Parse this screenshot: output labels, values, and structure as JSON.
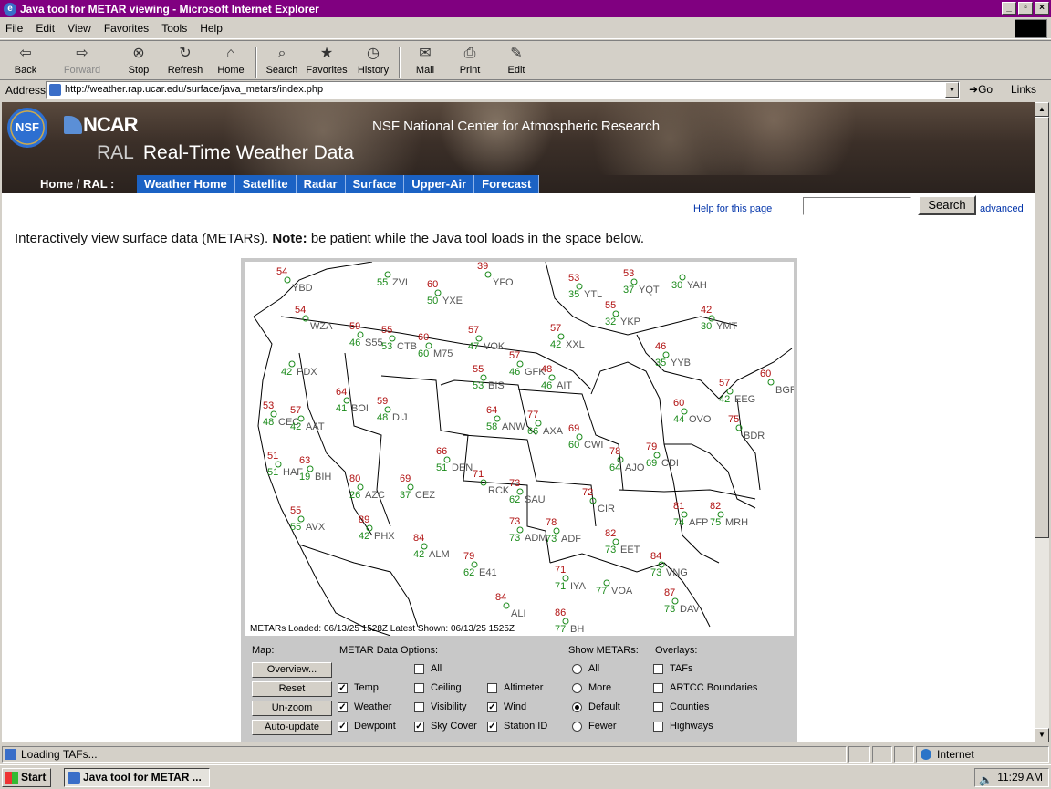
{
  "window": {
    "title": "Java tool for METAR viewing - Microsoft Internet Explorer"
  },
  "menu": [
    "File",
    "Edit",
    "View",
    "Favorites",
    "Tools",
    "Help"
  ],
  "toolbar": {
    "back": "Back",
    "forward": "Forward",
    "stop": "Stop",
    "refresh": "Refresh",
    "home": "Home",
    "search": "Search",
    "favorites": "Favorites",
    "history": "History",
    "mail": "Mail",
    "print": "Print",
    "edit": "Edit"
  },
  "address": {
    "label": "Address",
    "url": "http://weather.rap.ucar.edu/surface/java_metars/index.php",
    "go": "Go",
    "links": "Links"
  },
  "banner": {
    "nsf": "NSF",
    "ncar": "NCAR",
    "center": "NSF National Center for Atmospheric Research",
    "ral": "RAL",
    "title": "Real-Time Weather Data",
    "breadcrumb": "Home / RAL :",
    "tabs": [
      "Weather Home",
      "Satellite",
      "Radar",
      "Surface",
      "Upper-Air",
      "Forecast"
    ]
  },
  "search": {
    "help": "Help for this page",
    "button": "Search",
    "advanced": "advanced",
    "value": ""
  },
  "intro": {
    "text": "Interactively view surface data (METARs).",
    "note_label": "Note:",
    "note": "be patient while the Java tool loads in the space below."
  },
  "applet": {
    "status": "METARs Loaded: 06/13/25 1528Z Latest Shown: 06/13/25 1525Z",
    "map_label": "Map:",
    "map_buttons": [
      "Overview...",
      "Reset",
      "Un-zoom",
      "Auto-update"
    ],
    "metar_label": "METAR Data Options:",
    "options": [
      {
        "label": "All",
        "checked": false
      },
      {
        "label": "Temp",
        "checked": true
      },
      {
        "label": "Ceiling",
        "checked": false
      },
      {
        "label": "Altimeter",
        "checked": false
      },
      {
        "label": "Weather",
        "checked": true
      },
      {
        "label": "Visibility",
        "checked": false
      },
      {
        "label": "Wind",
        "checked": true
      },
      {
        "label": "Dewpoint",
        "checked": true
      },
      {
        "label": "Sky Cover",
        "checked": true
      },
      {
        "label": "Station ID",
        "checked": true
      }
    ],
    "show_label": "Show METARs:",
    "show": [
      {
        "label": "All",
        "selected": false
      },
      {
        "label": "More",
        "selected": false
      },
      {
        "label": "Default",
        "selected": true
      },
      {
        "label": "Fewer",
        "selected": false
      }
    ],
    "overlay_label": "Overlays:",
    "overlays": [
      {
        "label": "TAFs",
        "checked": false
      },
      {
        "label": "ARTCC Boundaries",
        "checked": false
      },
      {
        "label": "Counties",
        "checked": false
      },
      {
        "label": "Highways",
        "checked": false
      }
    ],
    "stations": [
      {
        "t": "54",
        "d": "",
        "id": "YBD"
      },
      {
        "t": "",
        "d": "55",
        "id": "ZVL"
      },
      {
        "t": "60",
        "d": "50",
        "id": "YXE"
      },
      {
        "t": "39",
        "d": "",
        "id": "YFO"
      },
      {
        "t": "53",
        "d": "35",
        "id": "YTL"
      },
      {
        "t": "53",
        "d": "37",
        "id": "YQT"
      },
      {
        "t": "",
        "d": "30",
        "id": "YAH"
      },
      {
        "t": "54",
        "d": "",
        "id": "WZA"
      },
      {
        "t": "59",
        "d": "46",
        "id": "S55"
      },
      {
        "t": "55",
        "d": "53",
        "id": "CTB"
      },
      {
        "t": "60",
        "d": "60",
        "id": "M75"
      },
      {
        "t": "57",
        "d": "47",
        "id": "VOK"
      },
      {
        "t": "57",
        "d": "42",
        "id": "XXL"
      },
      {
        "t": "55",
        "d": "32",
        "id": "YKP"
      },
      {
        "t": "42",
        "d": "30",
        "id": "YMT"
      },
      {
        "t": "",
        "d": "42",
        "id": "PDX"
      },
      {
        "t": "55",
        "d": "53",
        "id": "BIS"
      },
      {
        "t": "57",
        "d": "46",
        "id": "GFK"
      },
      {
        "t": "48",
        "d": "46",
        "id": "AIT"
      },
      {
        "t": "46",
        "d": "35",
        "id": "YYB"
      },
      {
        "t": "57",
        "d": "42",
        "id": "EEG"
      },
      {
        "t": "60",
        "d": "",
        "id": "BGR"
      },
      {
        "t": "53",
        "d": "48",
        "id": "CEC"
      },
      {
        "t": "57",
        "d": "42",
        "id": "AAT"
      },
      {
        "t": "64",
        "d": "41",
        "id": "BOI"
      },
      {
        "t": "59",
        "d": "48",
        "id": "DIJ"
      },
      {
        "t": "64",
        "d": "58",
        "id": "ANW"
      },
      {
        "t": "77",
        "d": "66",
        "id": "AXA"
      },
      {
        "t": "69",
        "d": "60",
        "id": "CWI"
      },
      {
        "t": "60",
        "d": "44",
        "id": "OVO"
      },
      {
        "t": "51",
        "d": "51",
        "id": "HAF"
      },
      {
        "t": "63",
        "d": "19",
        "id": "BIH"
      },
      {
        "t": "66",
        "d": "51",
        "id": "DEN"
      },
      {
        "t": "78",
        "d": "64",
        "id": "AJO"
      },
      {
        "t": "79",
        "d": "69",
        "id": "CDI"
      },
      {
        "t": "75",
        "d": "",
        "id": "BDR"
      },
      {
        "t": "80",
        "d": "26",
        "id": "AZC"
      },
      {
        "t": "69",
        "d": "37",
        "id": "CEZ"
      },
      {
        "t": "71",
        "d": "",
        "id": "RCK"
      },
      {
        "t": "73",
        "d": "62",
        "id": "SAU"
      },
      {
        "t": "72",
        "d": "",
        "id": "CIR"
      },
      {
        "t": "81",
        "d": "74",
        "id": "AFP"
      },
      {
        "t": "82",
        "d": "75",
        "id": "MRH"
      },
      {
        "t": "55",
        "d": "55",
        "id": "AVX"
      },
      {
        "t": "89",
        "d": "42",
        "id": "PHX"
      },
      {
        "t": "84",
        "d": "42",
        "id": "ALM"
      },
      {
        "t": "73",
        "d": "73",
        "id": "ADM"
      },
      {
        "t": "78",
        "d": "73",
        "id": "ADF"
      },
      {
        "t": "82",
        "d": "73",
        "id": "EET"
      },
      {
        "t": "84",
        "d": "73",
        "id": "VNG"
      },
      {
        "t": "79",
        "d": "62",
        "id": "E41"
      },
      {
        "t": "71",
        "d": "71",
        "id": "IYA"
      },
      {
        "t": "",
        "d": "77",
        "id": "VOA"
      },
      {
        "t": "87",
        "d": "73",
        "id": "DAV"
      },
      {
        "t": "84",
        "d": "",
        "id": "ALI"
      },
      {
        "t": "86",
        "d": "77",
        "id": "BH"
      }
    ]
  },
  "status": {
    "text": "Loading TAFs...",
    "zone": "Internet"
  },
  "taskbar": {
    "start": "Start",
    "task": "Java tool for METAR ...",
    "clock": "11:29 AM"
  }
}
